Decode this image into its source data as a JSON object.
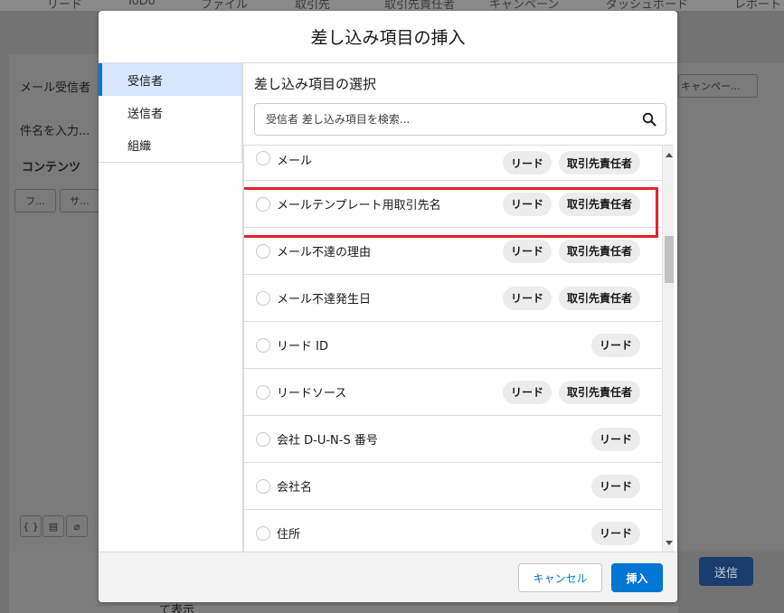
{
  "background": {
    "nav_items": [
      "リード",
      "ToDo",
      "ファイル",
      "取引先",
      "取引先責任者",
      "キャンペーン",
      "ダッシュボード",
      "レポート"
    ],
    "email_recipient_label": "メール受信者",
    "subject_placeholder": "件名を入力...",
    "content_label": "コンテンツ",
    "font_select": "フ...",
    "size_select": "サ...",
    "campaign_select": "キャンペー...",
    "send_label": "送信",
    "bottom_text": "て表示"
  },
  "modal": {
    "title": "差し込み項目の挿入",
    "nav": {
      "items": [
        {
          "label": "受信者",
          "active": true
        },
        {
          "label": "送信者",
          "active": false
        },
        {
          "label": "組織",
          "active": false
        }
      ]
    },
    "section_title": "差し込み項目の選択",
    "search": {
      "placeholder": "受信者 差し込み項目を検索..."
    },
    "fields": [
      {
        "label": "メール",
        "badges": [
          "リード",
          "取引先責任者"
        ]
      },
      {
        "label": "メールテンプレート用取引先名",
        "badges": [
          "リード",
          "取引先責任者"
        ]
      },
      {
        "label": "メール不達の理由",
        "badges": [
          "リード",
          "取引先責任者"
        ]
      },
      {
        "label": "メール不達発生日",
        "badges": [
          "リード",
          "取引先責任者"
        ]
      },
      {
        "label": "リード ID",
        "badges": [
          "リード"
        ]
      },
      {
        "label": "リードソース",
        "badges": [
          "リード",
          "取引先責任者"
        ]
      },
      {
        "label": "会社 D-U-N-S 番号",
        "badges": [
          "リード"
        ]
      },
      {
        "label": "会社名",
        "badges": [
          "リード"
        ]
      },
      {
        "label": "住所",
        "badges": [
          "リード"
        ]
      }
    ],
    "highlighted_index": 1,
    "footer": {
      "cancel_label": "キャンセル",
      "insert_label": "挿入"
    }
  },
  "colors": {
    "brand_blue": "#0176d3",
    "highlight_red": "#e3232c",
    "active_nav_bg": "#d8e6fe"
  }
}
